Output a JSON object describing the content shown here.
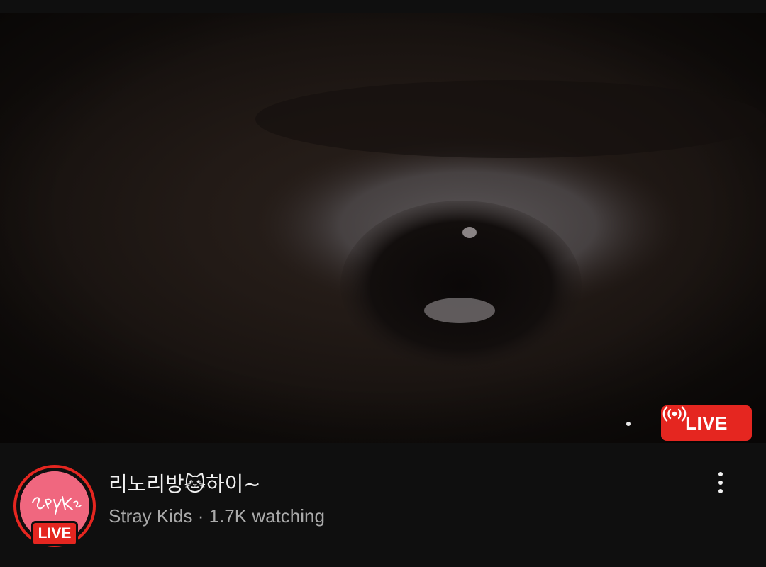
{
  "video": {
    "live_badge_label": "LIVE",
    "live_icon": "broadcast-icon"
  },
  "stream": {
    "title": "리노리방🐱하이~",
    "channel": "Stray Kids",
    "separator": "·",
    "viewers": "1.7K watching",
    "avatar_live_label": "LIVE",
    "avatar_logo_text": "Stray Kids"
  },
  "actions": {
    "more_icon": "more-vert-icon"
  },
  "colors": {
    "live_red": "#e52620",
    "avatar_pink": "#f0677f",
    "background": "#0f0f0f",
    "secondary_text": "#aaaaaa"
  }
}
